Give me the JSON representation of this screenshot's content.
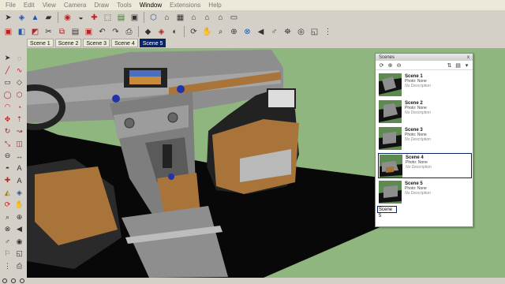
{
  "menubar": {
    "items": [
      "File",
      "Edit",
      "View",
      "Camera",
      "Draw",
      "Tools",
      "Window",
      "Extensions",
      "Help"
    ],
    "active_index": 6
  },
  "scene_tabs": [
    "Scene 1",
    "Scene 2",
    "Scene 3",
    "Scene 4",
    "Scene 5"
  ],
  "active_scene_tab": 4,
  "scenes_panel": {
    "title": "Scenes",
    "close_glyph": "x",
    "scenes": [
      {
        "name": "Scene 1",
        "photo": "Photo: None",
        "description": "No Description"
      },
      {
        "name": "Scene 2",
        "photo": "Photo: None",
        "description": "No Description"
      },
      {
        "name": "Scene 3",
        "photo": "Photo: None",
        "description": "No Description"
      },
      {
        "name": "Scene 4",
        "photo": "Photo: None",
        "description": "No Description"
      },
      {
        "name": "Scene 5",
        "photo": "Photo: None",
        "description": "No Description"
      }
    ],
    "selected_index": 3,
    "rename_value": "Scene 5"
  },
  "colors": {
    "ground": "#8fb67e",
    "floor": "#080808",
    "dashboard": "#9a9a9a",
    "wood": "#a8743a",
    "accent_blue": "#2233aa"
  },
  "icons": {
    "toolbar_top": [
      "select-arrow-icon",
      "component-icon",
      "paint-bucket-icon",
      "eraser-icon",
      "tape-measure-icon",
      "protractor-icon",
      "axes-icon",
      "dimension-icon",
      "text-icon",
      "3d-text-icon",
      "section-plane-icon",
      "iso-view-icon",
      "top-view-icon",
      "front-view-icon",
      "right-view-icon",
      "back-view-icon",
      "left-view-icon"
    ],
    "toolbar_bottom": [
      "new-file-icon",
      "open-icon",
      "save-icon",
      "cut-icon",
      "copy-icon",
      "paste-icon",
      "erase-icon",
      "undo-icon",
      "redo-icon",
      "print-icon",
      "model-info-icon",
      "push-pull-icon",
      "follow-me-icon",
      "offset-icon",
      "orbit-icon",
      "pan-icon",
      "zoom-icon",
      "zoom-window-icon",
      "zoom-extents-icon",
      "previous-view-icon",
      "position-camera-icon",
      "walk-icon",
      "look-around-icon",
      "section-icon",
      "footprint-icon"
    ],
    "left_toolbar": [
      "select-icon",
      "eraser-icon",
      "line-icon",
      "freehand-icon",
      "rectangle-icon",
      "rotated-rectangle-icon",
      "circle-icon",
      "polygon-icon",
      "arc-icon",
      "pie-icon",
      "move-icon",
      "push-pull-icon",
      "rotate-icon",
      "follow-me-icon",
      "scale-icon",
      "offset-icon",
      "tape-measure-icon",
      "dimension-icon",
      "protractor-icon",
      "text-icon",
      "axes-icon",
      "3d-text-icon",
      "paint-bucket-icon",
      "component-icon",
      "orbit-icon",
      "pan-icon",
      "zoom-icon",
      "zoom-window-icon",
      "zoom-extents-icon",
      "previous-icon",
      "position-camera-icon",
      "look-around-icon",
      "walk-icon",
      "section-plane-icon",
      "footprint-icon",
      "print-icon"
    ]
  }
}
